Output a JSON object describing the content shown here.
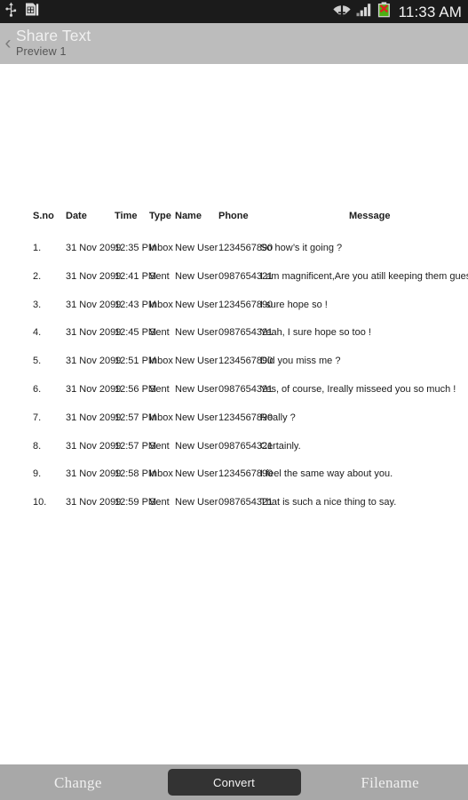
{
  "status_bar": {
    "background": "#1b1b1b",
    "clock": "11:33 AM",
    "left_icons": [
      {
        "name": "usb-icon",
        "label": "USB"
      },
      {
        "name": "sim-card-icon",
        "label": "SIM card"
      }
    ],
    "right_icons": [
      {
        "name": "wifi-icon",
        "label": "Wi-Fi"
      },
      {
        "name": "cellular-signal-icon",
        "label": "Signal"
      },
      {
        "name": "battery-error-icon",
        "label": "Battery error"
      }
    ]
  },
  "action_bar": {
    "background": "#bcbcbc",
    "back_label": "‹",
    "title": "Share Text",
    "subtitle": "Preview  1"
  },
  "table": {
    "headers": {
      "sno": "S.no",
      "date": "Date",
      "time": "Time",
      "type": "Type",
      "name": "Name",
      "phone": "Phone",
      "message": "Message"
    },
    "rows": [
      {
        "sno": "1.",
        "date": "31 Nov 2099",
        "time": "12:35 PM",
        "type": "Inbox",
        "name": "New User",
        "phone": "1234567890",
        "message": "So how’s it going ?"
      },
      {
        "sno": "2.",
        "date": "31 Nov 2099",
        "time": "12:41 PM",
        "type": "Sent",
        "name": "New User",
        "phone": "0987654321",
        "message": "I am magnificent,Are you atill keeping them guessing ?"
      },
      {
        "sno": "3.",
        "date": "31 Nov 2099",
        "time": "12:43 PM",
        "type": "Inbox",
        "name": "New User",
        "phone": "1234567890",
        "message": "I sure hope so !"
      },
      {
        "sno": "4.",
        "date": "31 Nov 2099",
        "time": "12:45 PM",
        "type": "Sent",
        "name": "New User",
        "phone": "0987654321",
        "message": "Yeah, I sure hope so too !"
      },
      {
        "sno": "5.",
        "date": "31 Nov 2099",
        "time": "12:51 PM",
        "type": "Inbox",
        "name": "New User",
        "phone": "1234567890",
        "message": "Did you miss me ?"
      },
      {
        "sno": "6.",
        "date": "31 Nov 2099",
        "time": "12:56 PM",
        "type": "Sent",
        "name": "New User",
        "phone": "0987654321",
        "message": "Yes, of course, Ireally misseed you so much !"
      },
      {
        "sno": "7.",
        "date": "31 Nov 2099",
        "time": "12:57 PM",
        "type": "Inbox",
        "name": "New User",
        "phone": "1234567890",
        "message": "Really ?"
      },
      {
        "sno": "8.",
        "date": "31 Nov 2099",
        "time": "12:57 PM",
        "type": "Sent",
        "name": "New User",
        "phone": "0987654321",
        "message": "Certainly."
      },
      {
        "sno": "9.",
        "date": "31 Nov 2099",
        "time": "12:58 PM",
        "type": "Inbox",
        "name": "New User",
        "phone": "1234567890",
        "message": "I feel the same way about you."
      },
      {
        "sno": "10.",
        "date": "31 Nov 2099",
        "time": "12:59 PM",
        "type": "Sent",
        "name": "New User",
        "phone": "0987654321",
        "message": "That is such a nice thing to say."
      }
    ]
  },
  "bottom_bar": {
    "background": "#a8a8a8",
    "change_label": "Change",
    "convert_label": "Convert",
    "filename_label": "Filename",
    "convert_color": "#333333"
  }
}
